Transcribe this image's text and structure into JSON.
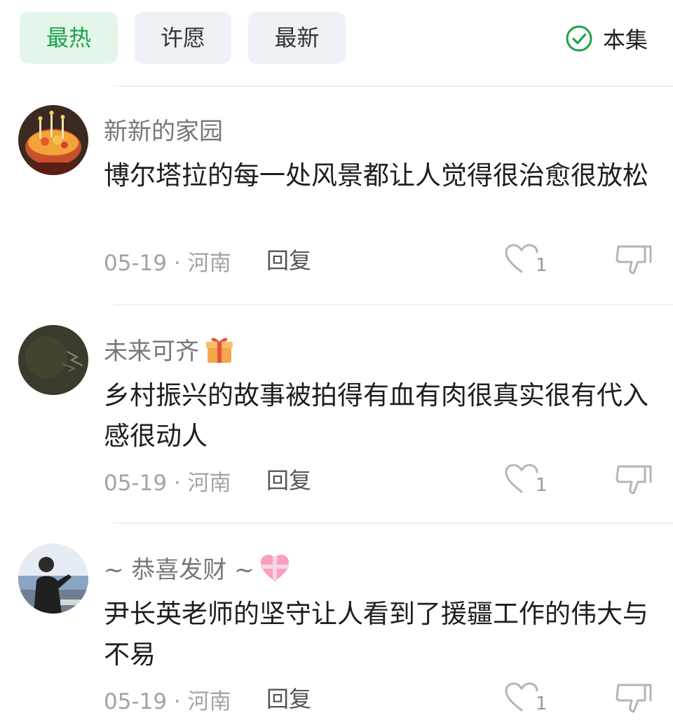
{
  "filters": {
    "tabs": [
      {
        "label": "最热",
        "active": true
      },
      {
        "label": "许愿",
        "active": false
      },
      {
        "label": "最新",
        "active": false
      }
    ],
    "episode_toggle": {
      "label": "本集",
      "checked": true,
      "icon": "check-circle-icon"
    }
  },
  "colors": {
    "accent": "#1aa34a",
    "chip_bg": "#eef2f7",
    "chip_active_bg": "#e4f6ea"
  },
  "comments": [
    {
      "username": "新新的家园",
      "content": "博尔塔拉的每一处风景都让人觉得很治愈很放松",
      "date_location": "05-19 · 河南",
      "reply_label": "回复",
      "like_count": "1",
      "avatar": "birthday-cake-avatar"
    },
    {
      "username": "未来可齐",
      "badge": "gift-icon",
      "content": "乡村振兴的故事被拍得有血有肉很真实很有代入感很动人",
      "date_location": "05-19 · 河南",
      "reply_label": "回复",
      "like_count": "1",
      "avatar": "night-avatar"
    },
    {
      "username": "~ 恭喜发财 ~",
      "badge": "heart-ribbon-icon",
      "content": "尹长英老师的坚守让人看到了援疆工作的伟大与不易",
      "date_location": "05-19 · 河南",
      "reply_label": "回复",
      "like_count": "1",
      "avatar": "person-seaside-avatar"
    }
  ]
}
